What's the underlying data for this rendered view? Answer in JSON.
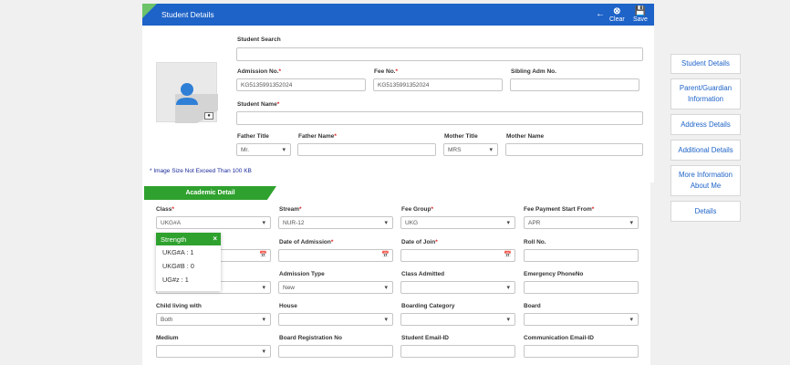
{
  "header": {
    "title": "Student Details",
    "clear_label": "Clear",
    "save_label": "Save"
  },
  "form": {
    "student_search_label": "Student Search",
    "admission_no_label": "Admission No.",
    "admission_no_value": "KG5135991352024",
    "fee_no_label": "Fee No.",
    "fee_no_value": "KG5135991352024",
    "sibling_adm_label": "Sibling Adm No.",
    "student_name_label": "Student Name",
    "father_title_label": "Father Title",
    "father_title_value": "Mr.",
    "father_name_label": "Father Name",
    "mother_title_label": "Mother Title",
    "mother_title_value": "MRS",
    "mother_name_label": "Mother Name",
    "required_mark": "*",
    "size_note": "* Image Size Not Exceed Than 100 KB"
  },
  "academic": {
    "tab_label": "Academic Detail",
    "class_label": "Class",
    "class_value": "UKG#A",
    "stream_label": "Stream",
    "stream_value": "NUR-12",
    "fee_group_label": "Fee Group",
    "fee_group_value": "UKG",
    "fee_start_label": "Fee Payment Start From",
    "fee_start_value": "APR",
    "doa_label": "Date of Admission",
    "doj_label": "Date of Join",
    "roll_label": "Roll No.",
    "admission_type_label": "Admission Type",
    "admission_type_value": "New",
    "class_admitted_label": "Class Admitted",
    "emergency_label": "Emergency PhoneNo",
    "child_living_label": "Child living with",
    "child_living_value": "Both",
    "house_label": "House",
    "boarding_label": "Boarding Category",
    "board_label": "Board",
    "medium_label": "Medium",
    "board_reg_label": "Board Registration No",
    "student_email_label": "Student Email-ID",
    "comm_email_label": "Communication Email-ID"
  },
  "strength_popup": {
    "title": "Strength",
    "items": [
      "UKG#A : 1",
      "UKG#B : 0",
      "UG#z : 1"
    ]
  },
  "side_nav": {
    "items": [
      "Student Details",
      "Parent/Guardian Information",
      "Address Details",
      "Additional Details",
      "More Information About Me",
      "Details"
    ]
  },
  "colors": {
    "header": "#1e63c8",
    "accent_green": "#2fa12e",
    "link_blue": "#1e63c8"
  }
}
